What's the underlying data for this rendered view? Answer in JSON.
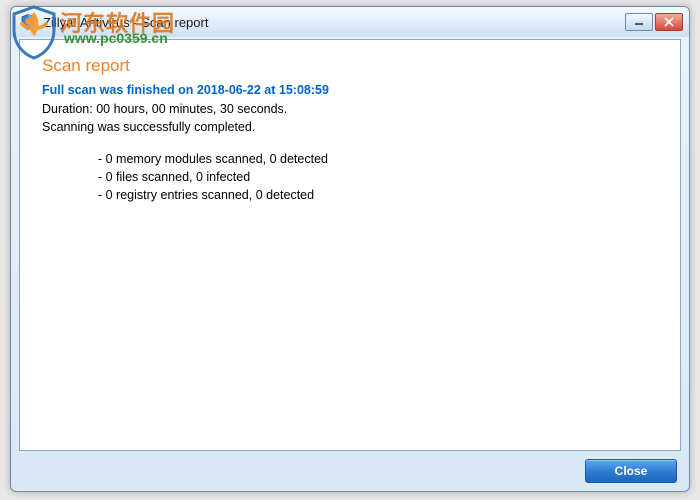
{
  "window": {
    "title": "Zillya! Antivirus - Scan report"
  },
  "report": {
    "heading": "Scan report",
    "finished_line": "Full scan was finished on 2018-06-22 at 15:08:59",
    "duration_line": "Duration: 00 hours, 00 minutes, 30 seconds.",
    "status_line": "Scanning was successfully completed.",
    "details": [
      "- 0 memory modules scanned, 0 detected",
      "- 0 files scanned, 0 infected",
      "- 0 registry entries scanned, 0 detected"
    ]
  },
  "buttons": {
    "close": "Close"
  },
  "watermark": {
    "cn_text": "河东软件园",
    "url_text": "www.pc0359.cn"
  }
}
